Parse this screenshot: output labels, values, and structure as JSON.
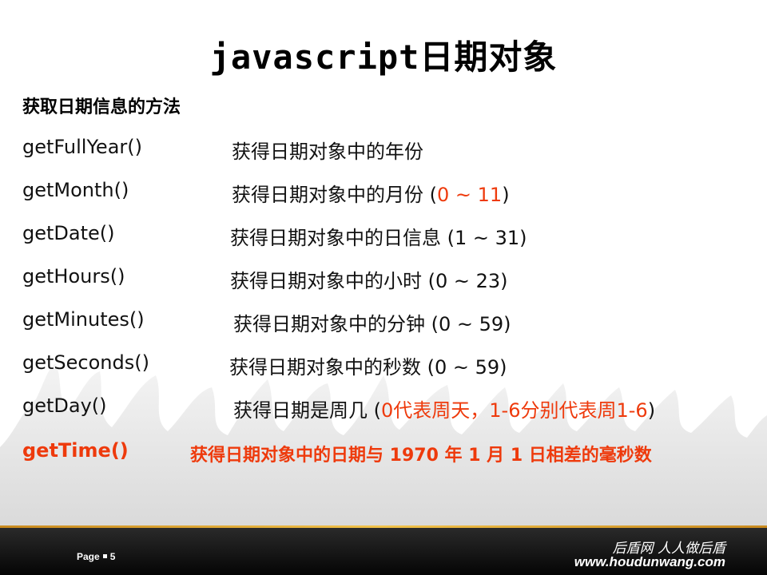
{
  "title": "javascript日期对象",
  "subtitle": "获取日期信息的方法",
  "methods": [
    {
      "name": "getFullYear()",
      "desc": "获得日期对象中的年份",
      "range": ""
    },
    {
      "name": "getMonth()",
      "desc": "获得日期对象中的月份 ",
      "range": "0 ~ 11"
    },
    {
      "name": "getDate()",
      "desc": "获得日期对象中的日信息 (1 ~ 31)",
      "range": ""
    },
    {
      "name": "getHours()",
      "desc": "获得日期对象中的小时 (0 ~ 23)",
      "range": ""
    },
    {
      "name": "getMinutes()",
      "desc": "获得日期对象中的分钟 (0 ~ 59)",
      "range": ""
    },
    {
      "name": "getSeconds()",
      "desc": "获得日期对象中的秒数 (0 ~ 59)",
      "range": ""
    },
    {
      "name": "getDay()",
      "desc": "获得日期是周几 ",
      "range": "0代表周天，1-6分别代表周1-6"
    },
    {
      "name": "getTime()",
      "desc": "获得日期对象中的日期与 1970 年 1 月 1 日相差的毫秒数",
      "range": ""
    }
  ],
  "footer": {
    "page_label": "Page",
    "page_number": "5",
    "brand_cn": "后盾网 人人做后盾",
    "brand_url": "www.houdunwang.com"
  },
  "colors": {
    "accent_red": "#ee3a0c",
    "footer_bar": "#111111",
    "footer_line": "#e3b13a"
  }
}
